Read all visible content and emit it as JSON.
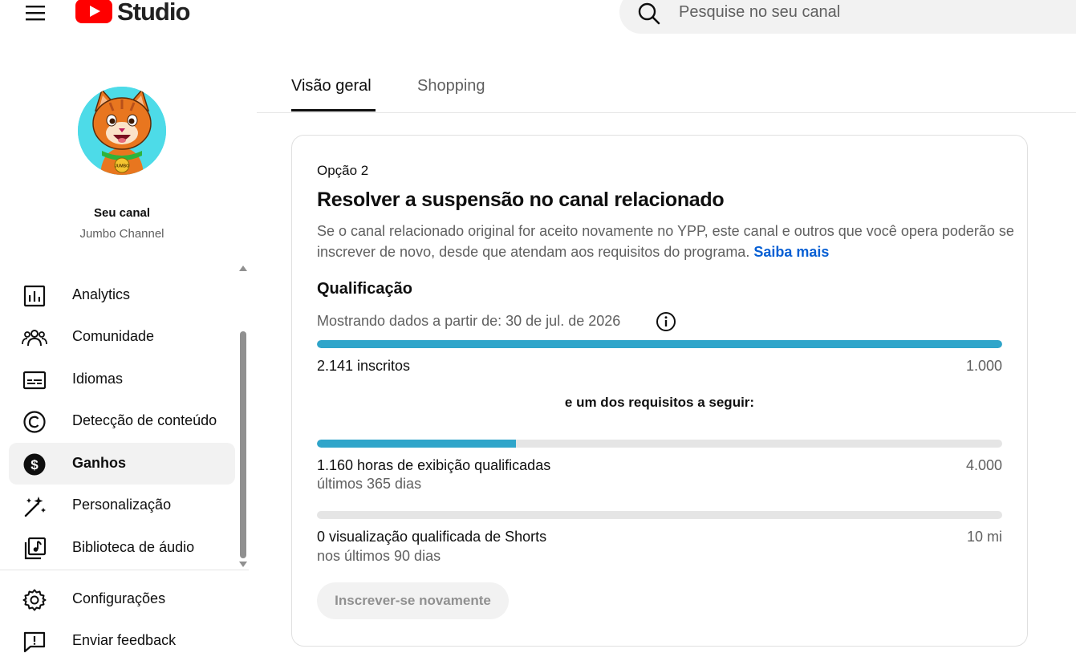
{
  "header": {
    "logo_text": "Studio",
    "search_placeholder": "Pesquise no seu canal"
  },
  "channel": {
    "label": "Seu canal",
    "name": "Jumbo Channel"
  },
  "sidebar": {
    "items": [
      {
        "label": "Analytics",
        "icon": "analytics-icon"
      },
      {
        "label": "Comunidade",
        "icon": "community-icon"
      },
      {
        "label": "Idiomas",
        "icon": "subtitles-icon"
      },
      {
        "label": "Detecção de conteúdo",
        "icon": "copyright-icon"
      },
      {
        "label": "Ganhos",
        "icon": "dollar-icon",
        "active": true
      },
      {
        "label": "Personalização",
        "icon": "magic-wand-icon"
      },
      {
        "label": "Biblioteca de áudio",
        "icon": "audio-library-icon"
      }
    ],
    "bottom_items": [
      {
        "label": "Configurações",
        "icon": "gear-icon"
      },
      {
        "label": "Enviar feedback",
        "icon": "feedback-icon"
      }
    ]
  },
  "tabs": [
    {
      "label": "Visão geral",
      "active": true
    },
    {
      "label": "Shopping"
    }
  ],
  "card": {
    "option": "Opção 2",
    "title": "Resolver a suspensão no canal relacionado",
    "description": "Se o canal relacionado original for aceito novamente no YPP, este canal e outros que você opera poderão se inscrever de novo, desde que atendam aos requisitos do programa.",
    "learn_more": "Saiba mais",
    "qualification_title": "Qualificação",
    "data_date": "Mostrando dados a partir de: 30 de jul. de 2026",
    "subscribers": {
      "label": "2.141 inscritos",
      "target": "1.000",
      "progress": 1.0
    },
    "requirement_text": "e um dos requisitos a seguir:",
    "watch_hours": {
      "label": "1.160 horas de exibição qualificadas",
      "sub": "últimos 365 dias",
      "target": "4.000",
      "progress": 0.29
    },
    "shorts_views": {
      "label": "0 visualização qualificada de Shorts",
      "sub": "nos últimos 90 dias",
      "target": "10 mi",
      "progress": 0
    },
    "button": "Inscrever-se novamente"
  },
  "colors": {
    "progress_fill": "#2fa5ca",
    "link": "#065fd4",
    "youtube_red": "#ff0000"
  }
}
